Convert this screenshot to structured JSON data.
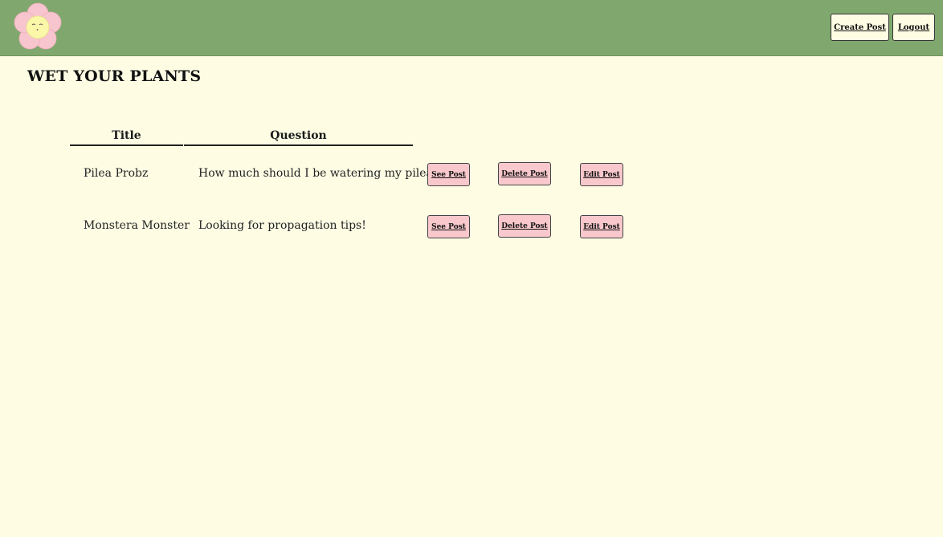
{
  "header": {
    "logo_icon": "flower-logo-icon",
    "create_post_label": "Create Post",
    "logout_label": "Logout"
  },
  "page": {
    "title": "WET YOUR PLANTS"
  },
  "table": {
    "columns": [
      "Title",
      "Question"
    ],
    "rows": [
      {
        "title": "Pilea Probz",
        "question": "How much should I be watering my pilea?",
        "see_label": "See Post",
        "delete_label": "Delete Post",
        "edit_label": "Edit Post"
      },
      {
        "title": "Monstera Monster",
        "question": "Looking for propagation tips!",
        "see_label": "See Post",
        "delete_label": "Delete Post",
        "edit_label": "Edit Post"
      }
    ]
  },
  "colors": {
    "navbar": "#80a86e",
    "background": "#fefde4",
    "row_button": "#f8c8cc",
    "petal": "#f7c5cd",
    "flower_center": "#fbf7a8"
  }
}
